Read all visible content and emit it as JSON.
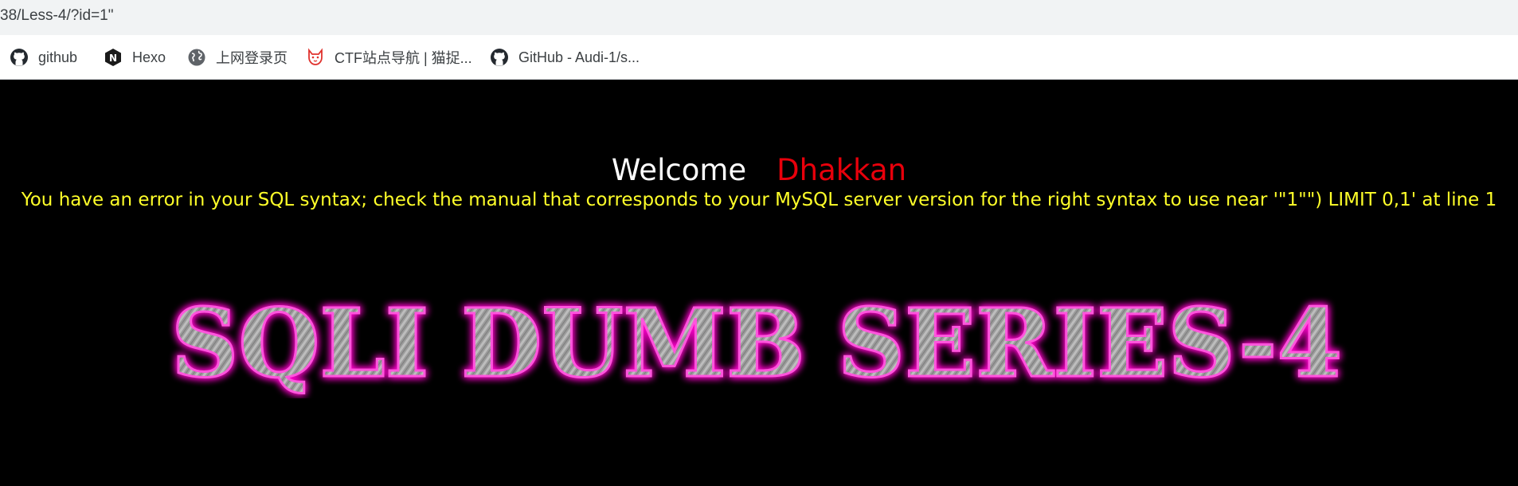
{
  "browser": {
    "url": "38/Less-4/?id=1\"",
    "bookmarks": [
      {
        "label": "github",
        "icon": "github-icon"
      },
      {
        "label": "Hexo",
        "icon": "hexo-icon"
      },
      {
        "label": "上网登录页",
        "icon": "globe-icon"
      },
      {
        "label": "CTF站点导航 | 猫捉...",
        "icon": "cat-icon"
      },
      {
        "label": "GitHub - Audi-1/s...",
        "icon": "github-icon"
      }
    ]
  },
  "page": {
    "welcome": "Welcome",
    "name": "Dhakkan",
    "error": "You have an error in your SQL syntax; check the manual that corresponds to your MySQL server version for the right syntax to use near '\"1\"\") LIMIT 0,1' at line 1",
    "banner": "SQLI DUMB SERIES-4"
  },
  "colors": {
    "background": "#000000",
    "welcome": "#ffffff",
    "name": "#e8000b",
    "error": "#ffff29",
    "banner_glow": "#ff00cc",
    "banner_fill": "#a8a8a8"
  }
}
